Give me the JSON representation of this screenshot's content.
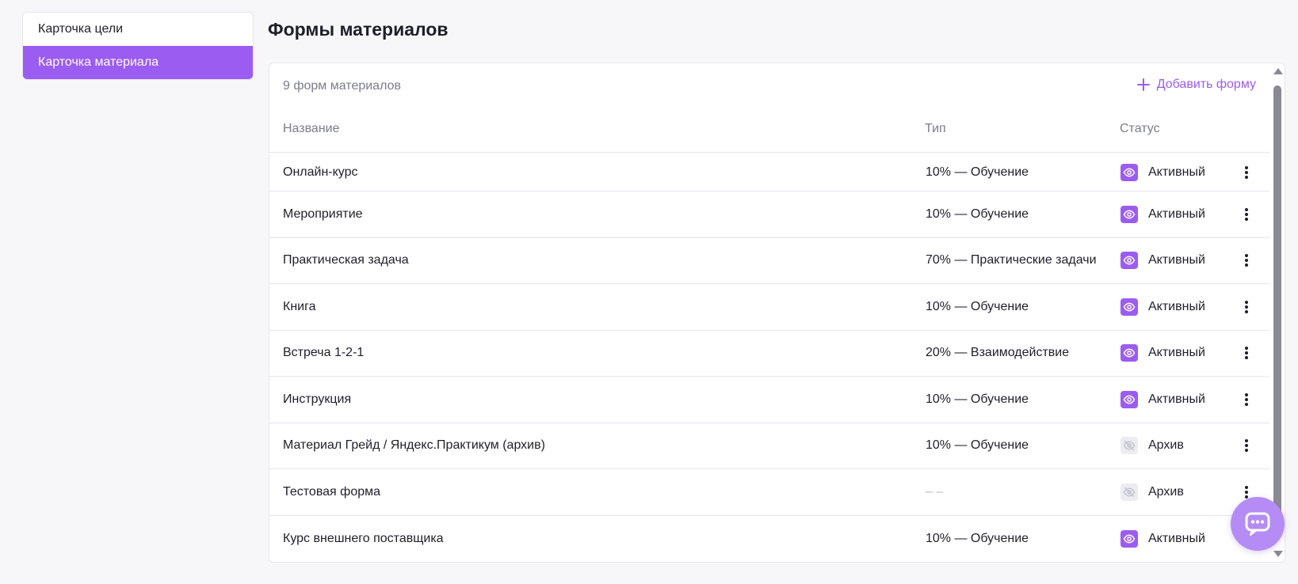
{
  "sidebar": {
    "items": [
      {
        "label": "Карточка цели",
        "active": false
      },
      {
        "label": "Карточка материала",
        "active": true
      }
    ]
  },
  "page": {
    "title": "Формы материалов"
  },
  "panel": {
    "count_text": "9 форм материалов",
    "add_label": "Добавить форму"
  },
  "table": {
    "columns": {
      "name": "Название",
      "type": "Тип",
      "status": "Статус"
    },
    "rows": [
      {
        "name": "Онлайн-курс",
        "type": "10% — Обучение",
        "status": "Активный",
        "active": true
      },
      {
        "name": "Мероприятие",
        "type": "10% — Обучение",
        "status": "Активный",
        "active": true
      },
      {
        "name": "Практическая задача",
        "type": "70% — Практические задачи",
        "status": "Активный",
        "active": true
      },
      {
        "name": "Книга",
        "type": "10% — Обучение",
        "status": "Активный",
        "active": true
      },
      {
        "name": "Встреча 1-2-1",
        "type": "20% — Взаимодействие",
        "status": "Активный",
        "active": true
      },
      {
        "name": "Инструкция",
        "type": "10% — Обучение",
        "status": "Активный",
        "active": true
      },
      {
        "name": "Материал Грейд / Яндекс.Практикум (архив)",
        "type": "10% — Обучение",
        "status": "Архив",
        "active": false
      },
      {
        "name": "Тестовая форма",
        "type": "– –",
        "status": "Архив",
        "active": false
      },
      {
        "name": "Курс внешнего поставщика",
        "type": "10% — Обучение",
        "status": "Активный",
        "active": true
      }
    ]
  },
  "icons": {
    "add": "plus-icon",
    "status_active": "eye-icon",
    "status_archive": "eye-off-icon",
    "row_menu": "kebab-menu-icon",
    "chat": "chat-bubble-icon"
  },
  "colors": {
    "accent": "#9b5cf2",
    "chat": "#b58cf5",
    "muted_text": "#7c7c8c",
    "archive_icon_bg": "#ececf2"
  }
}
